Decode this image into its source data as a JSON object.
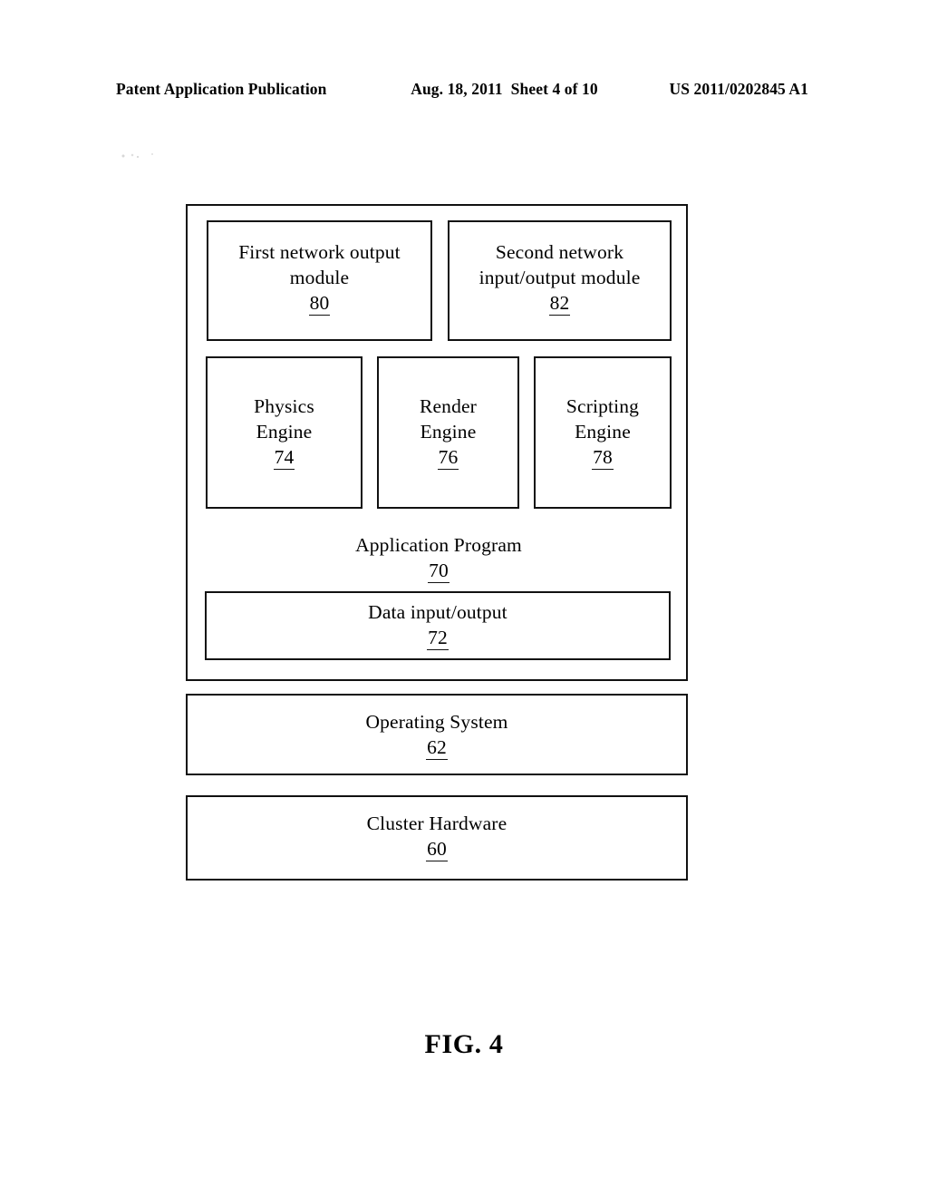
{
  "header": {
    "publication": "Patent Application Publication",
    "date": "Aug. 18, 2011",
    "sheet": "Sheet 4 of 10",
    "pub_number": "US 2011/0202845 A1"
  },
  "diagram": {
    "blocks": [
      {
        "id": "first-network-output-module",
        "line1": "First network output",
        "line2": "module",
        "ref": "80"
      },
      {
        "id": "second-network-io-module",
        "line1": "Second network",
        "line2": "input/output module",
        "ref": "82"
      },
      {
        "id": "physics-engine",
        "line1": "Physics",
        "line2": "Engine",
        "ref": "74"
      },
      {
        "id": "render-engine",
        "line1": "Render",
        "line2": "Engine",
        "ref": "76"
      },
      {
        "id": "scripting-engine",
        "line1": "Scripting",
        "line2": "Engine",
        "ref": "78"
      },
      {
        "id": "application-program",
        "line1": "Application Program",
        "ref": "70"
      },
      {
        "id": "data-input-output",
        "line1": "Data input/output",
        "ref": "72"
      },
      {
        "id": "operating-system",
        "line1": "Operating System",
        "ref": "62"
      },
      {
        "id": "cluster-hardware",
        "line1": "Cluster Hardware",
        "ref": "60"
      }
    ]
  },
  "figure": {
    "caption": "FIG. 4"
  }
}
